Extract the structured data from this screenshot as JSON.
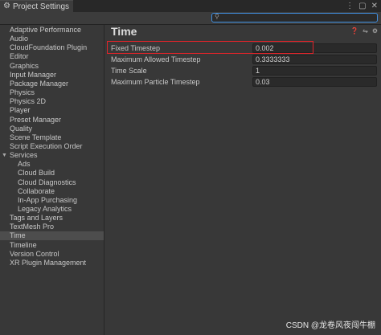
{
  "window": {
    "tab_title": "Project Settings"
  },
  "search": {
    "value": ""
  },
  "sidebar": {
    "items": [
      {
        "label": "Adaptive Performance",
        "indent": 0
      },
      {
        "label": "Audio",
        "indent": 0
      },
      {
        "label": "CloudFoundation Plugin",
        "indent": 0
      },
      {
        "label": "Editor",
        "indent": 0
      },
      {
        "label": "Graphics",
        "indent": 0
      },
      {
        "label": "Input Manager",
        "indent": 0
      },
      {
        "label": "Package Manager",
        "indent": 0
      },
      {
        "label": "Physics",
        "indent": 0
      },
      {
        "label": "Physics 2D",
        "indent": 0
      },
      {
        "label": "Player",
        "indent": 0
      },
      {
        "label": "Preset Manager",
        "indent": 0
      },
      {
        "label": "Quality",
        "indent": 0
      },
      {
        "label": "Scene Template",
        "indent": 0
      },
      {
        "label": "Script Execution Order",
        "indent": 0
      },
      {
        "label": "Services",
        "indent": 0,
        "expanded": true
      },
      {
        "label": "Ads",
        "indent": 1
      },
      {
        "label": "Cloud Build",
        "indent": 1
      },
      {
        "label": "Cloud Diagnostics",
        "indent": 1
      },
      {
        "label": "Collaborate",
        "indent": 1
      },
      {
        "label": "In-App Purchasing",
        "indent": 1
      },
      {
        "label": "Legacy Analytics",
        "indent": 1
      },
      {
        "label": "Tags and Layers",
        "indent": 0
      },
      {
        "label": "TextMesh Pro",
        "indent": 0
      },
      {
        "label": "Time",
        "indent": 0,
        "selected": true
      },
      {
        "label": "Timeline",
        "indent": 0
      },
      {
        "label": "Version Control",
        "indent": 0
      },
      {
        "label": "XR Plugin Management",
        "indent": 0
      }
    ]
  },
  "main": {
    "title": "Time",
    "fields": [
      {
        "label": "Fixed Timestep",
        "value": "0.002"
      },
      {
        "label": "Maximum Allowed Timestep",
        "value": "0.3333333"
      },
      {
        "label": "Time Scale",
        "value": "1"
      },
      {
        "label": "Maximum Particle Timestep",
        "value": "0.03"
      }
    ]
  },
  "watermark": "CSDN @龙卷风夜闯牛棚",
  "colors": {
    "highlight": "#e0242a",
    "selection": "#4d4d4d",
    "search_focus": "#3f8fe0"
  }
}
